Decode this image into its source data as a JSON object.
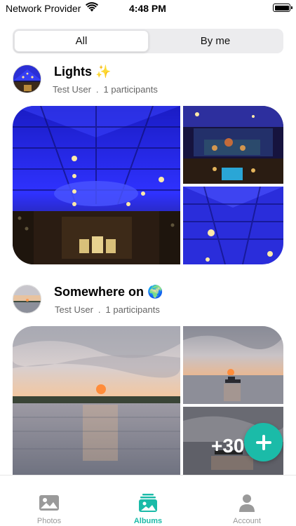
{
  "status_bar": {
    "carrier": "Network Provider",
    "time": "4:48 PM",
    "wifi_icon": "wifi-icon",
    "battery_icon": "battery-icon"
  },
  "segmented_control": {
    "options": [
      {
        "label": "All",
        "selected": true
      },
      {
        "label": "By me",
        "selected": false
      }
    ]
  },
  "albums": [
    {
      "title": "Lights ✨",
      "owner": "Test User",
      "separator": ".",
      "participants": "1 participants",
      "photos": [
        "concert-hall-blue-lights",
        "stage-decorations",
        "ceiling-lanterns"
      ]
    },
    {
      "title": "Somewhere on 🌍",
      "owner": "Test User",
      "separator": ".",
      "participants": "1 participants",
      "photos": [
        "sunset-over-sea",
        "sunset-with-boat",
        "sea-sunset"
      ],
      "more_count": "+30"
    }
  ],
  "fab": {
    "icon": "plus-icon"
  },
  "tab_bar": {
    "items": [
      {
        "label": "Photos",
        "icon": "photo-icon",
        "active": false
      },
      {
        "label": "Albums",
        "icon": "albums-icon",
        "active": true
      },
      {
        "label": "Account",
        "icon": "person-icon",
        "active": false
      }
    ]
  },
  "colors": {
    "accent": "#1bbba8",
    "inactive": "#999999",
    "lights_blue": "#2a2cff"
  }
}
